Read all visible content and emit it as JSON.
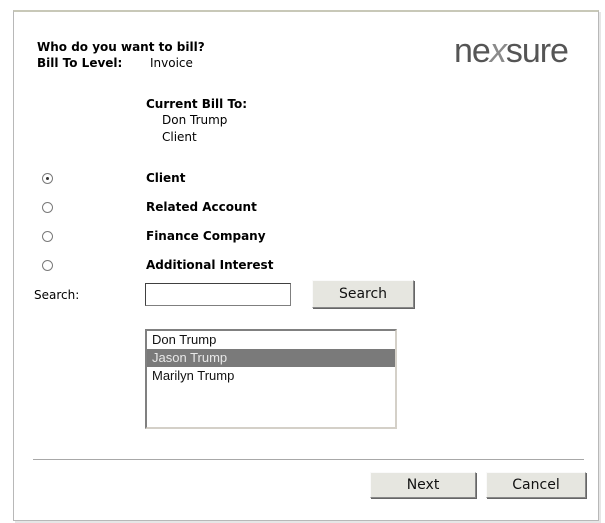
{
  "header": {
    "question": "Who do you want to bill?",
    "bill_to_level_label": "Bill To Level:",
    "bill_to_level_value": "Invoice"
  },
  "logo": {
    "part1": "ne",
    "part2": "x",
    "part3": "sure"
  },
  "current_bill_to": {
    "label": "Current Bill To:",
    "name": "Don Trump",
    "type": "Client"
  },
  "options": [
    {
      "label": "Client",
      "checked": true
    },
    {
      "label": "Related Account",
      "checked": false
    },
    {
      "label": "Finance Company",
      "checked": false
    },
    {
      "label": "Additional Interest",
      "checked": false
    }
  ],
  "search": {
    "label": "Search:",
    "value": "",
    "button_label": "Search"
  },
  "results": {
    "items": [
      "Don Trump",
      "Jason Trump",
      "Marilyn Trump"
    ],
    "selected_index": 1
  },
  "footer": {
    "next_label": "Next",
    "cancel_label": "Cancel"
  }
}
